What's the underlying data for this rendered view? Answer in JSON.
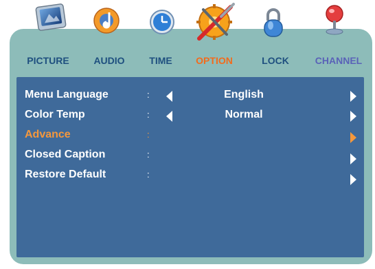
{
  "tabs": [
    {
      "label": "PICTURE",
      "icon": "picture-icon"
    },
    {
      "label": "AUDIO",
      "icon": "audio-icon"
    },
    {
      "label": "TIME",
      "icon": "clock-icon"
    },
    {
      "label": "OPTION",
      "icon": "tools-icon",
      "active": true
    },
    {
      "label": "LOCK",
      "icon": "lock-icon"
    },
    {
      "label": "CHANNEL",
      "icon": "satellite-dish-icon"
    }
  ],
  "menu": {
    "items": [
      {
        "label": "Menu Language",
        "separator": ":",
        "value": "English"
      },
      {
        "label": "Color Temp",
        "separator": ":",
        "value": "Normal"
      },
      {
        "label": "Advance",
        "separator": ":",
        "value": "",
        "selected": true
      },
      {
        "label": "Closed Caption",
        "separator": ":",
        "value": ""
      },
      {
        "label": "Restore Default",
        "separator": ":",
        "value": ""
      }
    ]
  },
  "colors": {
    "frame": "#8dbcb9",
    "panel": "#3f6a9a",
    "tab_text": "#1e4f7f",
    "active_tab_text": "#f26b1c",
    "selected_item": "#f5983c",
    "channel_tab_text": "#5a62b8"
  }
}
